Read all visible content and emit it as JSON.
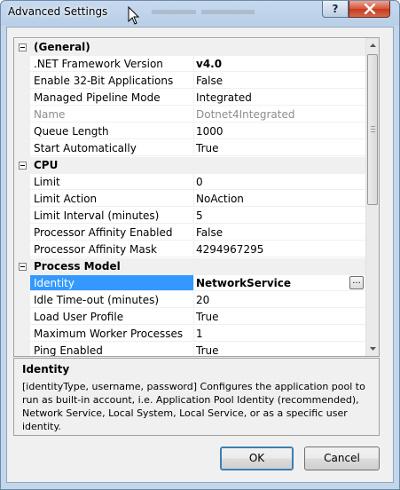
{
  "window": {
    "title": "Advanced Settings",
    "help_label": "?",
    "close_label": "x"
  },
  "grid": {
    "categories": [
      {
        "label": "(General)",
        "rows": [
          {
            "name": ".NET Framework Version",
            "value": "v4.0",
            "bold": true
          },
          {
            "name": "Enable 32-Bit Applications",
            "value": "False"
          },
          {
            "name": "Managed Pipeline Mode",
            "value": "Integrated"
          },
          {
            "name": "Name",
            "value": "Dotnet4Integrated",
            "disabled": true
          },
          {
            "name": "Queue Length",
            "value": "1000"
          },
          {
            "name": "Start Automatically",
            "value": "True"
          }
        ]
      },
      {
        "label": "CPU",
        "rows": [
          {
            "name": "Limit",
            "value": "0"
          },
          {
            "name": "Limit Action",
            "value": "NoAction"
          },
          {
            "name": "Limit Interval (minutes)",
            "value": "5"
          },
          {
            "name": "Processor Affinity Enabled",
            "value": "False"
          },
          {
            "name": "Processor Affinity Mask",
            "value": "4294967295"
          }
        ]
      },
      {
        "label": "Process Model",
        "rows": [
          {
            "name": "Identity",
            "value": "NetworkService",
            "bold": true,
            "selected": true,
            "ellipsis": "..."
          },
          {
            "name": "Idle Time-out (minutes)",
            "value": "20"
          },
          {
            "name": "Load User Profile",
            "value": "True"
          },
          {
            "name": "Maximum Worker Processes",
            "value": "1"
          },
          {
            "name": "Ping Enabled",
            "value": "True"
          }
        ]
      }
    ]
  },
  "description": {
    "title": "Identity",
    "body": "[identityType, username, password] Configures the application pool to run as built-in account, i.e. Application Pool Identity (recommended), Network Service, Local System, Local Service, or as a specific user identity."
  },
  "buttons": {
    "ok": "OK",
    "cancel": "Cancel"
  }
}
